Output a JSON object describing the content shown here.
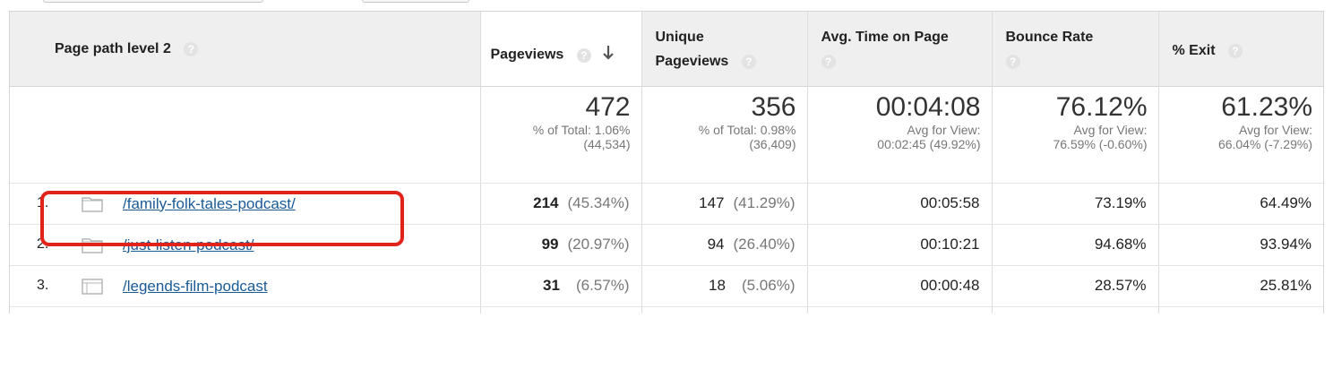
{
  "header": {
    "dimension": "Page path level 2",
    "pageviews": "Pageviews",
    "unique_line1": "Unique",
    "unique_line2": "Pageviews",
    "avg_time": "Avg. Time on Page",
    "bounce_rate": "Bounce Rate",
    "exit": "% Exit",
    "help_glyph": "?"
  },
  "totals": {
    "pageviews": {
      "value": "472",
      "line1": "% of Total: 1.06%",
      "line2": "(44,534)"
    },
    "unique": {
      "value": "356",
      "line1": "% of Total: 0.98%",
      "line2": "(36,409)"
    },
    "avg_time": {
      "value": "00:04:08",
      "line1": "Avg for View:",
      "line2": "00:02:45 (49.92%)"
    },
    "bounce": {
      "value": "76.12%",
      "line1": "Avg for View:",
      "line2": "76.59% (-0.60%)"
    },
    "exit": {
      "value": "61.23%",
      "line1": "Avg for View:",
      "line2": "66.04% (-7.29%)"
    }
  },
  "rows": [
    {
      "num": "1.",
      "icon": "folder-icon",
      "path": "/family-folk-tales-podcast/",
      "pageviews": "214",
      "pageviews_pct": "(45.34%)",
      "unique": "147",
      "unique_pct": "(41.29%)",
      "avg_time": "00:05:58",
      "bounce": "73.19%",
      "exit": "64.49%"
    },
    {
      "num": "2.",
      "icon": "folder-icon",
      "path": "/just-listen-podcast/",
      "pageviews": "99",
      "pageviews_pct": "(20.97%)",
      "unique": "94",
      "unique_pct": "(26.40%)",
      "avg_time": "00:10:21",
      "bounce": "94.68%",
      "exit": "93.94%"
    },
    {
      "num": "3.",
      "icon": "page-icon",
      "path": "/legends-film-podcast",
      "pageviews": "31",
      "pageviews_pct": "(6.57%)",
      "unique": "18",
      "unique_pct": "(5.06%)",
      "avg_time": "00:00:48",
      "bounce": "28.57%",
      "exit": "25.81%"
    }
  ],
  "colors": {
    "link": "#1a5a96",
    "highlight": "#e2231a",
    "header_bg": "#efefef"
  }
}
